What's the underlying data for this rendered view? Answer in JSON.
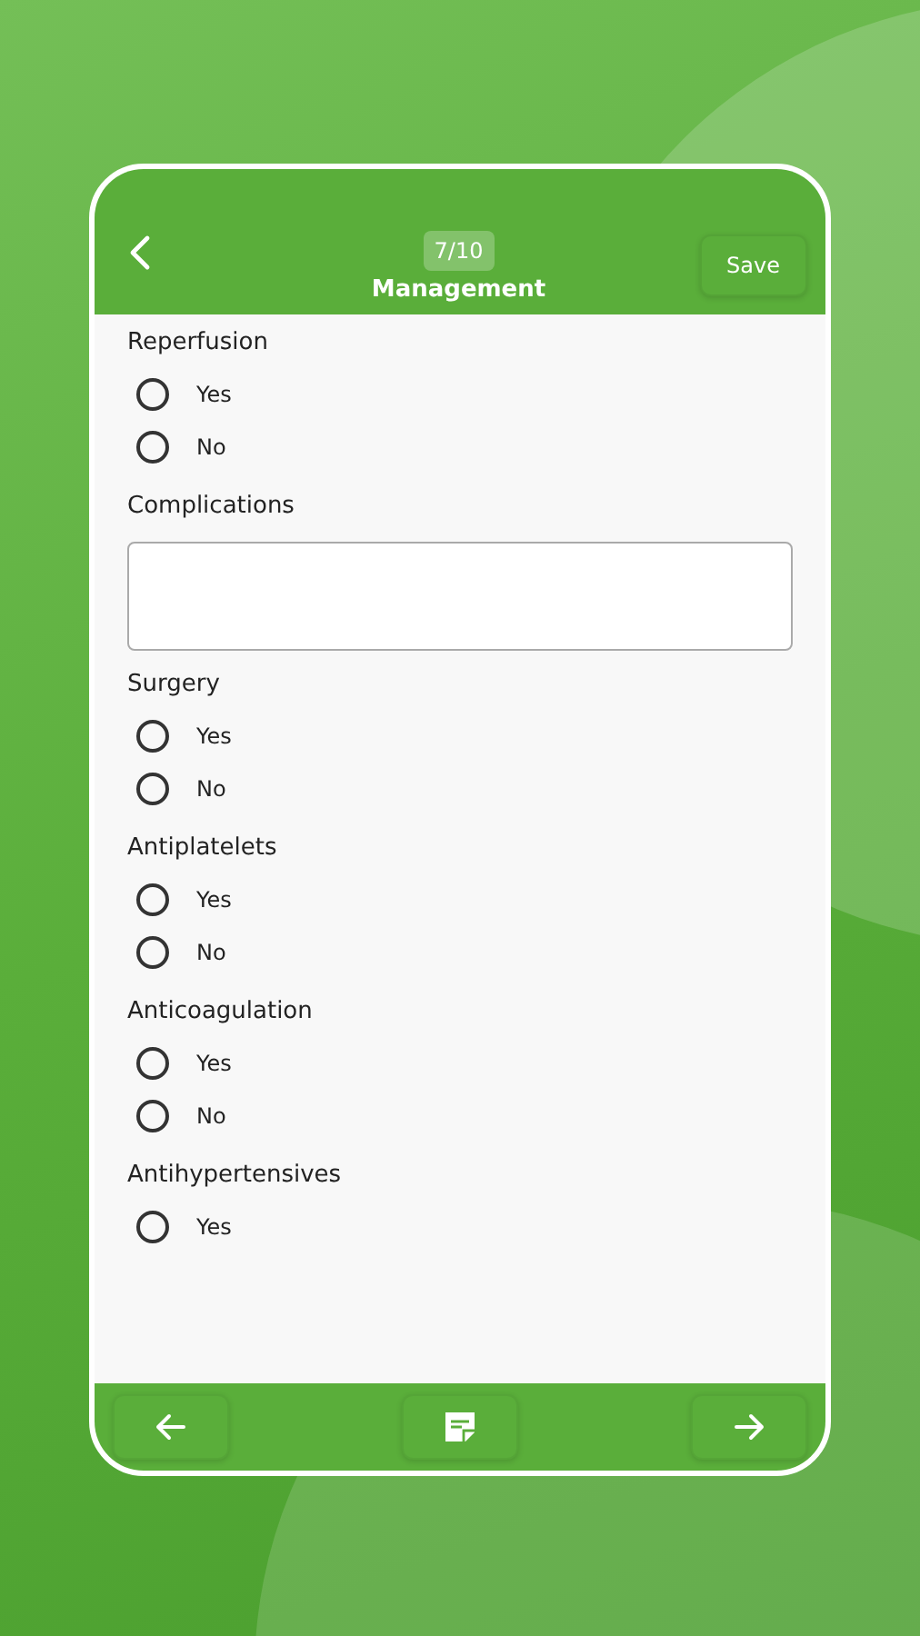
{
  "header": {
    "step": "7/10",
    "title": "Management",
    "save_button": "Save"
  },
  "questions": [
    {
      "kind": "radio",
      "label": "Reperfusion",
      "options": [
        {
          "label": "Yes",
          "selected": false
        },
        {
          "label": "No",
          "selected": false
        }
      ]
    },
    {
      "kind": "text",
      "label": "Complications"
    },
    {
      "kind": "radio",
      "label": "Surgery",
      "options": [
        {
          "label": "Yes",
          "selected": false
        },
        {
          "label": "No",
          "selected": false
        }
      ]
    },
    {
      "kind": "radio",
      "label": "Antiplatelets",
      "options": [
        {
          "label": "Yes",
          "selected": false
        },
        {
          "label": "No",
          "selected": false
        }
      ]
    },
    {
      "kind": "radio",
      "label": "Anticoagulation",
      "options": [
        {
          "label": "Yes",
          "selected": false
        },
        {
          "label": "No",
          "selected": false
        }
      ]
    },
    {
      "kind": "radio",
      "label": "Antihypertensives",
      "options": [
        {
          "label": "Yes",
          "selected": false
        }
      ]
    }
  ]
}
